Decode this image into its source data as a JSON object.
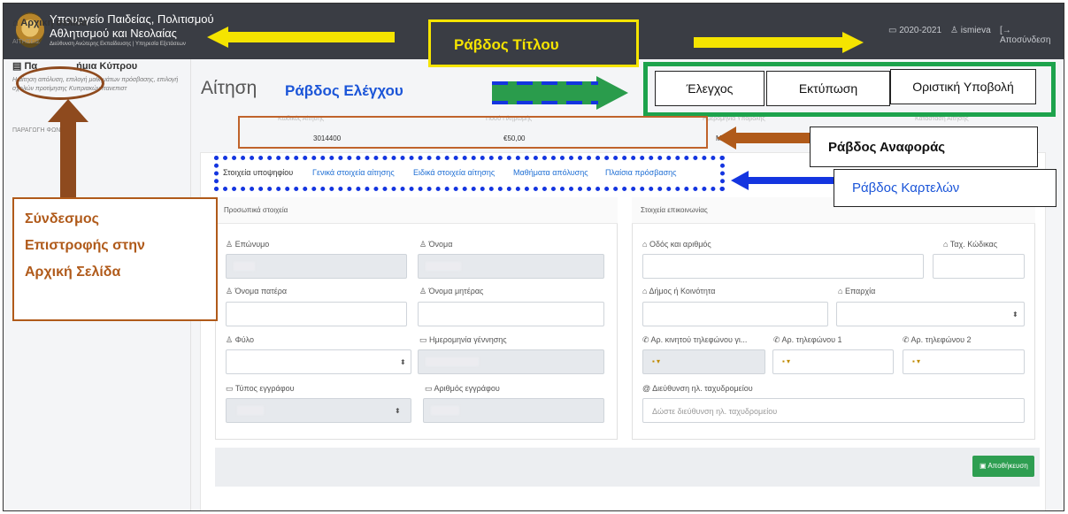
{
  "header": {
    "org_line1": "Υπουργείο Παιδείας, Πολιτισμού",
    "org_line2": "Αθλητισμού και Νεολαίας",
    "org_line3": "Διεύθυνση Ανώτερης Εκπαίδευσης | Υπηρεσία Εξετάσεων",
    "year": "2020-2021",
    "user": "ismieva",
    "logout": "Αποσύνδεση"
  },
  "sidebar": {
    "home": "Αρχική σελίδα",
    "applications_heading": "ΑΙΤΗΣΕΙΣ",
    "item": "Παγκύπριες Εξετάσεις / Πανεπιστήμια Κύπρου",
    "item_short_pre": "Πα",
    "item_short_post": "ήμια Κύπρου",
    "item_desc": "Η αίτηση      απόλυση, επιλογή μαθημάτων πρόσβασης,     επιλογή σχολών προτίμησης Κυπριακών πανεπιστ",
    "section2": "ΠΑΡΑΓΩΓΗ         ΦΩΝ"
  },
  "page": {
    "title": "Αίτηση",
    "ref_labels": [
      "Κωδικός Αίτησης",
      "Ποσό Πληρωμής",
      "Ημερομηνία Υποβολής",
      "Κατάσταση Αίτησης"
    ],
    "ref_values": [
      "3014400",
      "€50,00",
      "Μ..."
    ]
  },
  "tabs": [
    "Στοιχεία υποψηφίου",
    "Γενικά στοιχεία αίτησης",
    "Ειδικά στοιχεία αίτησης",
    "Μαθήματα απόλυσης",
    "Πλαίσια πρόσβασης"
  ],
  "personal": {
    "heading": "Προσωπικά στοιχεία",
    "surname": "Επώνυμο",
    "name": "Όνομα",
    "father": "Όνομα πατέρα",
    "mother": "Όνομα μητέρας",
    "gender": "Φύλο",
    "dob": "Ημερομηνία γέννησης",
    "doc_type": "Τύπος εγγράφου",
    "doc_no": "Αριθμός εγγράφου"
  },
  "contact": {
    "heading": "Στοιχεία επικοινωνίας",
    "street": "Οδός και αριθμός",
    "postcode": "Ταχ. Κώδικας",
    "municipality": "Δήμος ή Κοινότητα",
    "district": "Επαρχία",
    "mobile": "Αρ. κινητού τηλεφώνου γι...",
    "phone1": "Αρ. τηλεφώνου 1",
    "phone2": "Αρ. τηλεφώνου 2",
    "email": "Διεύθυνση ηλ. ταχυδρομείου",
    "email_placeholder": "Δώστε διεύθυνση ηλ. ταχυδρομείου"
  },
  "save_label": "Αποθήκευση",
  "annotations": {
    "title_bar": "Ράβδος Τίτλου",
    "control_bar": "Ράβδος Ελέγχου",
    "check": "Έλεγχος",
    "print": "Εκτύπωση",
    "final_submit": "Οριστική Υποβολή",
    "reference_bar": "Ράβδος Αναφοράς",
    "tabs_bar": "Ράβδος Καρτελών",
    "home_link_1": "Σύνδεσμος",
    "home_link_2": "Επιστροφής στην",
    "home_link_3": "Αρχική Σελίδα"
  },
  "colors": {
    "header_bg": "#3a3d44",
    "accent_blue": "#1f6fd4",
    "save_green": "#2e9e51",
    "annotation_yellow": "#f5e400",
    "annotation_green": "#1da34c",
    "annotation_brown": "#b05a1a"
  }
}
